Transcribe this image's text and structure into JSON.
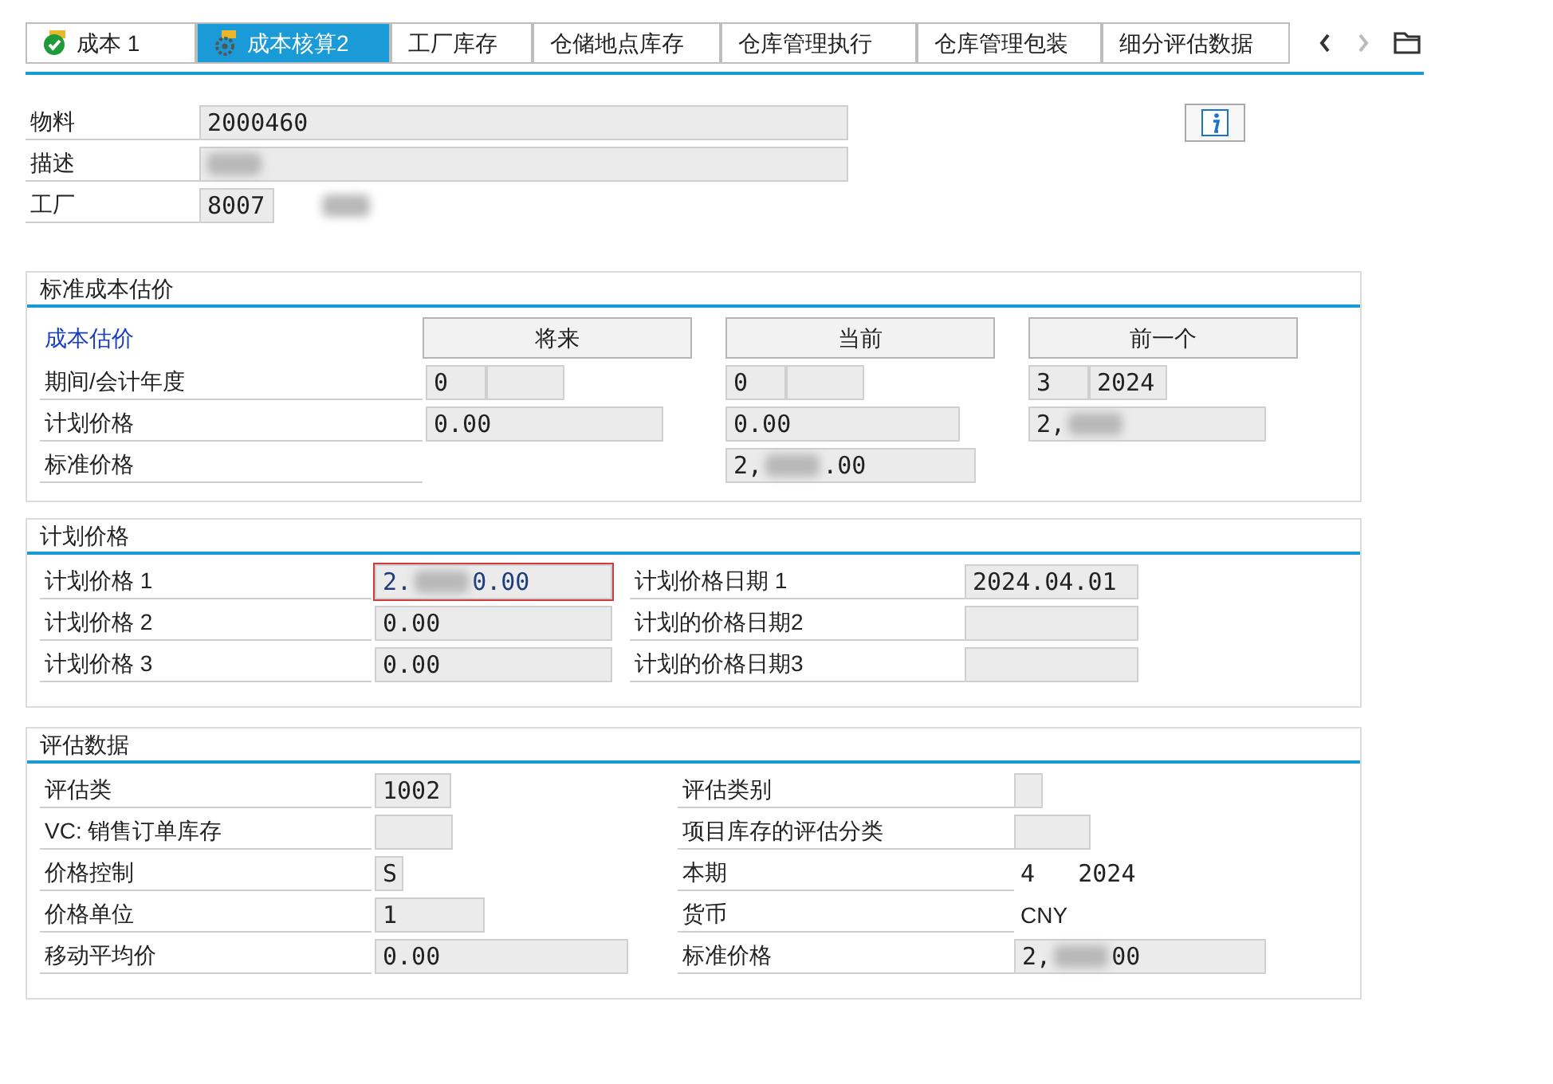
{
  "tabs": [
    {
      "label": "成本 1",
      "selected": false
    },
    {
      "label": "成本核算2",
      "selected": true
    },
    {
      "label": "工厂库存",
      "selected": false
    },
    {
      "label": "仓储地点库存",
      "selected": false
    },
    {
      "label": "仓库管理执行",
      "selected": false
    },
    {
      "label": "仓库管理包装",
      "selected": false
    },
    {
      "label": "细分评估数据",
      "selected": false
    }
  ],
  "header": {
    "fields": [
      {
        "label": "物料",
        "value": "2000460"
      },
      {
        "label": "描述",
        "segments": [
          {
            "kind": "blur"
          }
        ]
      },
      {
        "label": "工厂",
        "value": "8007",
        "note_blurred": true
      }
    ]
  },
  "standard_cost": {
    "title": "标准成本估价",
    "row_header": "成本估价",
    "columns": [
      "将来",
      "当前",
      "前一个"
    ],
    "rows": [
      {
        "label": "期间/会计年度",
        "kind": "period",
        "cells": [
          {
            "period": "0"
          },
          {
            "period": "0"
          },
          {
            "period": "3",
            "year": "2024"
          }
        ]
      },
      {
        "label": "计划价格",
        "kind": "price",
        "cells": [
          {
            "value": "0.00"
          },
          {
            "value": "0.00"
          },
          {
            "segments": [
              {
                "kind": "text",
                "text": "2,"
              },
              {
                "kind": "blur"
              }
            ]
          }
        ]
      },
      {
        "label": "标准价格",
        "kind": "price",
        "cells": [
          null,
          {
            "segments": [
              {
                "kind": "text",
                "text": "2,"
              },
              {
                "kind": "blur"
              },
              {
                "kind": "text",
                "text": ".00"
              }
            ]
          },
          null
        ]
      }
    ]
  },
  "planned_price": {
    "title": "计划价格",
    "rows": [
      {
        "label": "计划价格 1",
        "segments": [
          {
            "kind": "text",
            "text": "2."
          },
          {
            "kind": "blur"
          },
          {
            "kind": "text",
            "text": "0.00"
          }
        ],
        "focused": true,
        "date_label": "计划价格日期 1",
        "date": "2024.04.01"
      },
      {
        "label": "计划价格 2",
        "value": "0.00",
        "focused": false,
        "date_label": "计划的价格日期2"
      },
      {
        "label": "计划价格 3",
        "value": "0.00",
        "focused": false,
        "date_label": "计划的价格日期3"
      }
    ]
  },
  "valuation": {
    "title": "评估数据",
    "rows": [
      {
        "label": "评估类",
        "value": "1002",
        "right_label": "评估类别",
        "right": {
          "kind": "field"
        }
      },
      {
        "label": "VC: 销售订单库存",
        "right_label": "项目库存的评估分类",
        "right": {
          "kind": "field"
        }
      },
      {
        "label": "价格控制",
        "value": "S",
        "right_label": "本期",
        "right": {
          "kind": "text",
          "value": "4   2024"
        }
      },
      {
        "label": "价格单位",
        "value": "1",
        "right_label": "货币",
        "right": {
          "kind": "text",
          "value": "CNY"
        }
      },
      {
        "label": "移动平均价",
        "value": "0.00",
        "right_label": "标准价格",
        "right": {
          "kind": "field",
          "segments": [
            {
              "kind": "text",
              "text": "2,"
            },
            {
              "kind": "blur"
            },
            {
              "kind": "text",
              "text": "00"
            }
          ]
        }
      }
    ]
  }
}
